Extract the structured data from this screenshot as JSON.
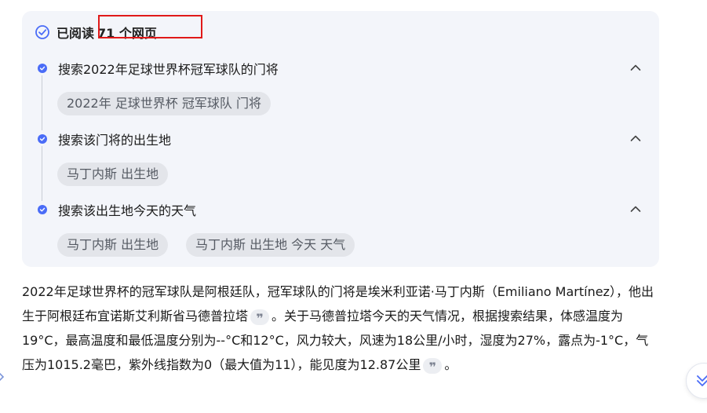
{
  "reading": {
    "prefix": "已阅读",
    "count": "71 个网页"
  },
  "steps": [
    {
      "title": "搜索2022年足球世界杯冠军球队的门将",
      "queries": [
        "2022年 足球世界杯 冠军球队 门将"
      ]
    },
    {
      "title": "搜索该门将的出生地",
      "queries": [
        "马丁内斯 出生地"
      ]
    },
    {
      "title": "搜索该出生地今天的天气",
      "queries": [
        "马丁内斯 出生地",
        "马丁内斯 出生地 今天 天气"
      ]
    }
  ],
  "answer": {
    "part1": "2022年足球世界杯的冠军球队是阿根廷队，冠军球队的门将是埃米利亚诺·马丁内斯（Emiliano Martínez），他出生于阿根廷布宜诺斯艾利斯省马德普拉塔",
    "part2": "。关于马德普拉塔今天的天气情况，根据搜索结果，体感温度为19°C，最高温度和最低温度分别为--°C和12°C，风力较大，风速为18公里/小时，湿度为27%，露点为-1°C，气压为1015.2毫巴，紫外线指数为0（最大值为11），能见度为12.87公里",
    "part3": "。",
    "cite_mark": "❞"
  },
  "colors": {
    "accent": "#4a6cf7",
    "panel_bg": "#f3f5fa",
    "chip_bg": "#e3e5ea",
    "highlight": "#e01919"
  },
  "icons": [
    "check-circle-icon",
    "step-dot-icon",
    "chevron-up-icon",
    "quote-icon",
    "double-chevron-down-icon"
  ]
}
